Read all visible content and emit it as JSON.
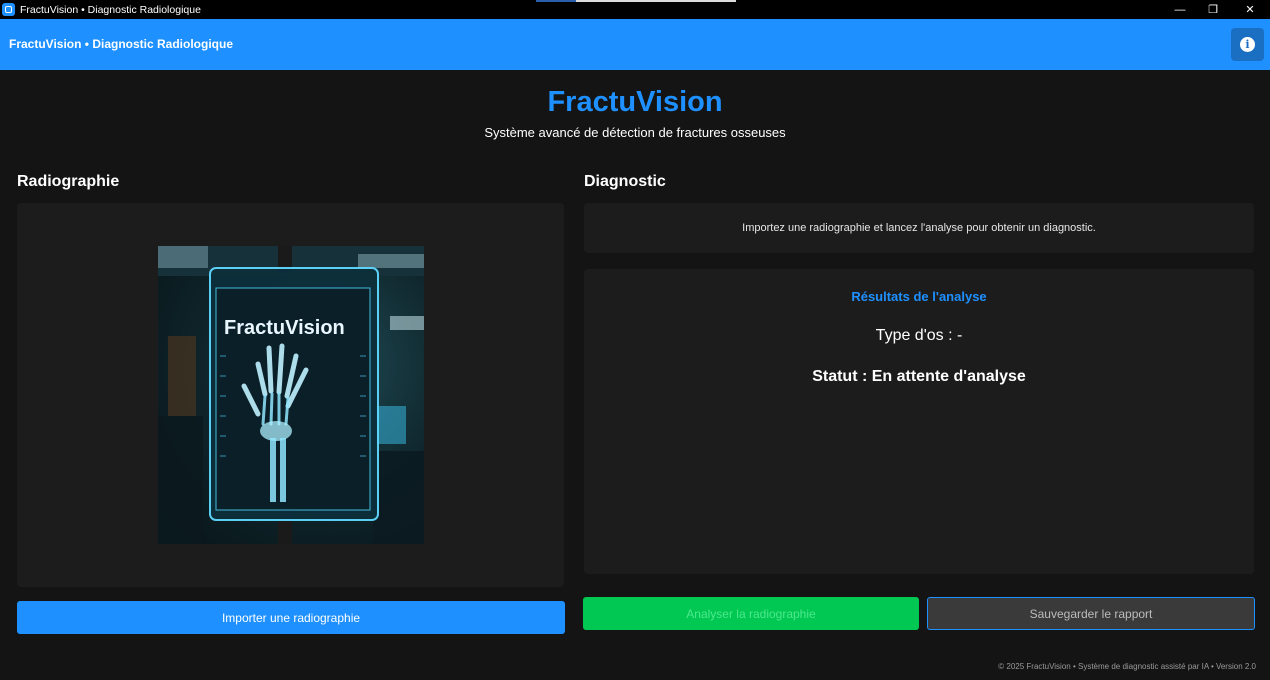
{
  "window": {
    "title": "FractuVision • Diagnostic Radiologique",
    "minimize": "—",
    "restore": "❐",
    "close": "✕"
  },
  "header": {
    "title": "FractuVision • Diagnostic Radiologique",
    "info_icon": "i"
  },
  "hero": {
    "title": "FractuVision",
    "subtitle": "Système avancé de détection de fractures osseuses"
  },
  "radiography": {
    "section_title": "Radiographie",
    "image_logo_text": "FractuVision",
    "import_button": "Importer une radiographie"
  },
  "diagnostic": {
    "section_title": "Diagnostic",
    "instruction": "Importez une radiographie et lancez l'analyse pour obtenir un diagnostic.",
    "results_title": "Résultats de l'analyse",
    "bone_type": "Type d'os : -",
    "status": "Statut : En attente d'analyse",
    "analyze_button": "Analyser la radiographie",
    "save_button": "Sauvegarder le rapport"
  },
  "footer": {
    "text": "© 2025 FractuVision • Système de diagnostic assisté par IA • Version 2.0"
  },
  "colors": {
    "accent": "#1e90ff",
    "success": "#00c853",
    "background": "#141414",
    "panel": "#1c1c1c"
  }
}
